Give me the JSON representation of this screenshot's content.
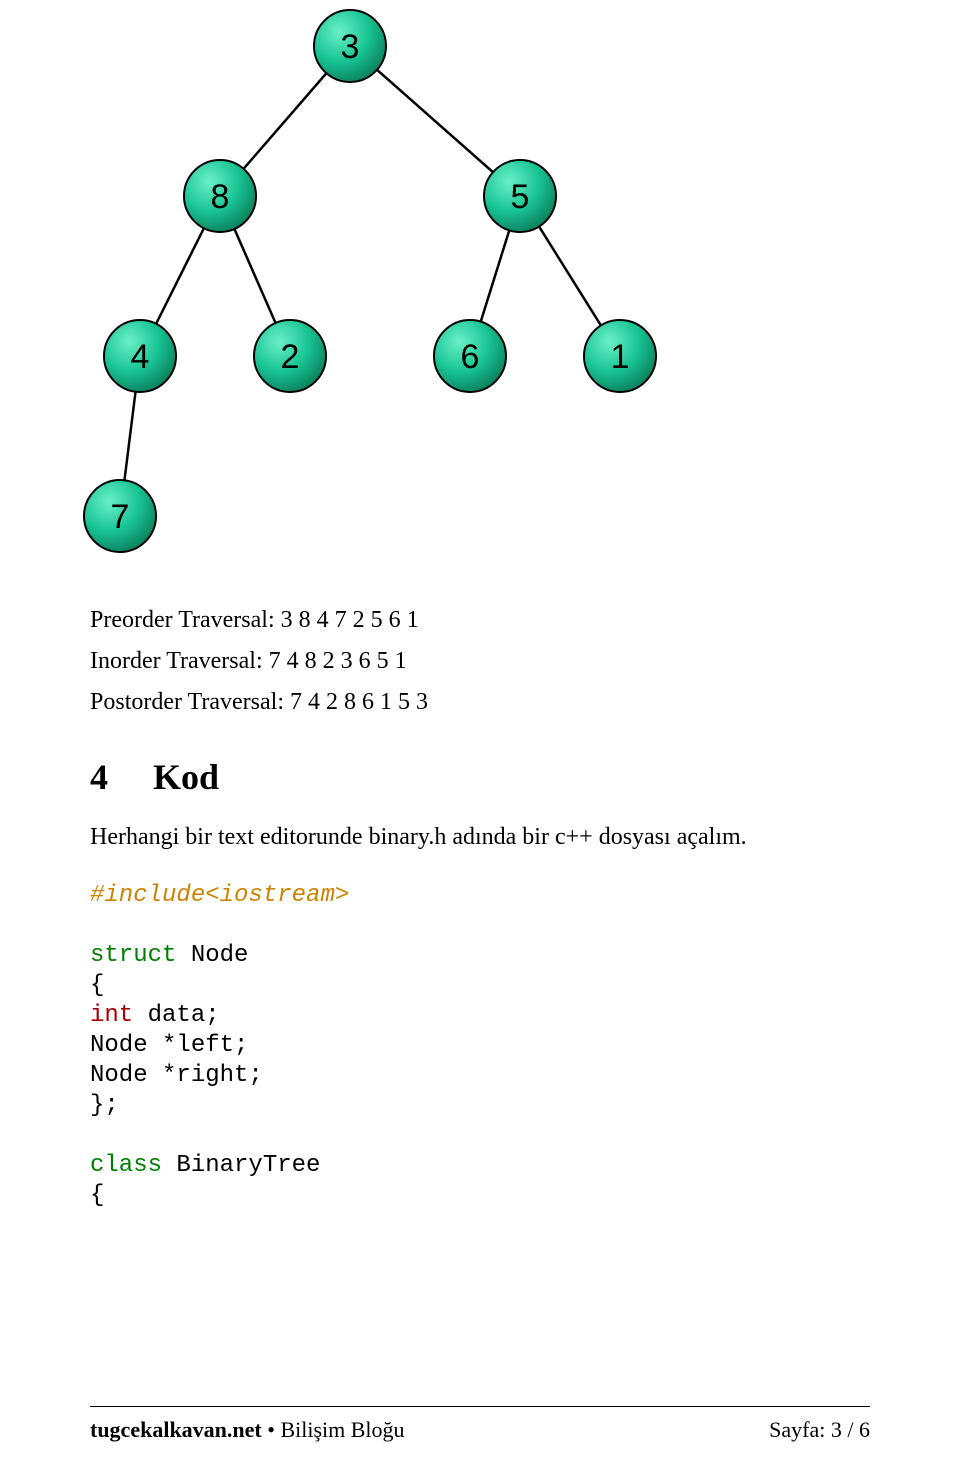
{
  "tree": {
    "nodes": {
      "root": "3",
      "l": "8",
      "r": "5",
      "ll": "4",
      "lr": "2",
      "rl": "6",
      "rr": "1",
      "lll": "7"
    }
  },
  "traversals": {
    "preorder_label": "Preorder Traversal:",
    "preorder_value": "3 8 4 7 2 5 6 1",
    "inorder_label": "Inorder Traversal:",
    "inorder_value": "7 4 8 2 3 6 5 1",
    "postorder_label": "Postorder Traversal:",
    "postorder_value": "7 4 2 8 6 1 5 3"
  },
  "section": {
    "number": "4",
    "title": "Kod"
  },
  "body": {
    "p1": "Herhangi bir text editorunde binary.h adında bir c++ dosyası açalım."
  },
  "code": {
    "l1": "#include<iostream>",
    "l2": "struct",
    "l2b": " Node",
    "l3": "{",
    "l4": "int",
    "l4b": " data;",
    "l5": "Node *left;",
    "l6": "Node *right;",
    "l7": "};",
    "l8": "class",
    "l8b": " BinaryTree",
    "l9": "{"
  },
  "footer": {
    "left_bold": "tugcekalkavan.net",
    "left_rest_bullet": " • ",
    "left_rest": "Bilişim Bloğu",
    "right_label": "Sayfa: ",
    "right_value": "3 / 6"
  }
}
